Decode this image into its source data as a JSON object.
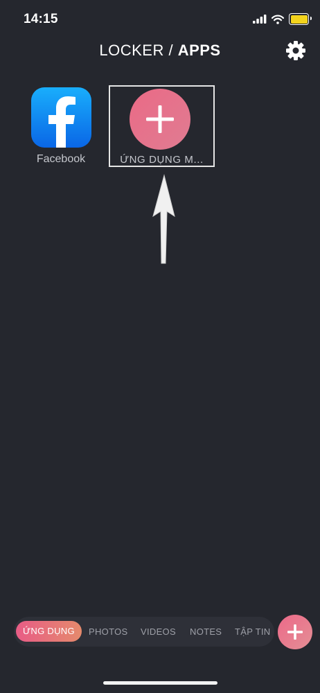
{
  "status_bar": {
    "time": "14:15",
    "battery_color": "#f3d31c"
  },
  "header": {
    "title_light": "LOCKER / ",
    "title_bold": "APPS",
    "settings_icon": "gear-icon"
  },
  "apps": [
    {
      "label": "Facebook",
      "icon": "facebook-icon"
    },
    {
      "label": "ỨNG DỤNG M...",
      "icon": "plus-icon"
    }
  ],
  "tabs": [
    {
      "label": "ỨNG DỤNG",
      "active": true
    },
    {
      "label": "PHOTOS",
      "active": false
    },
    {
      "label": "VIDEOS",
      "active": false
    },
    {
      "label": "NOTES",
      "active": false
    },
    {
      "label": "TẬP TIN",
      "active": false
    }
  ],
  "colors": {
    "background": "#25272e",
    "accent": "#e8688a",
    "facebook": "#0a66e6"
  }
}
